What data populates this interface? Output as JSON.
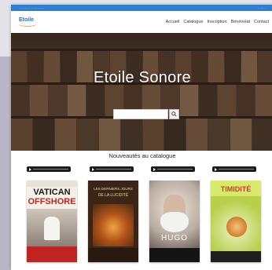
{
  "site": {
    "logo_text": "Etoile",
    "nav": [
      "Accueil",
      "Catalogue",
      "Inscription",
      "Bénévolat",
      "Contact"
    ]
  },
  "hero": {
    "title": "Etoile Sonore"
  },
  "section_title": "Nouveautés au catalogue",
  "books": [
    {
      "top": "VATICAN",
      "mid": "OFFSHORE",
      "bg": "#f4f0e8",
      "accent": "#c0251f"
    },
    {
      "top": "LES DERNIERS JOURS",
      "mid": "DE LA LUCIDITÉ",
      "bg": "#3a2516",
      "accent": "#c86d1f"
    },
    {
      "top": "",
      "mid": "HUGO",
      "bg": "#d9d1c8",
      "accent": "#1a1a1a"
    },
    {
      "top": "TIMIDITÉ",
      "mid": "",
      "bg": "#cfe25a",
      "accent": "#d33a2b"
    }
  ],
  "colors": {
    "topbar": "#2f7fd0",
    "logo": "#2f6fb8"
  }
}
